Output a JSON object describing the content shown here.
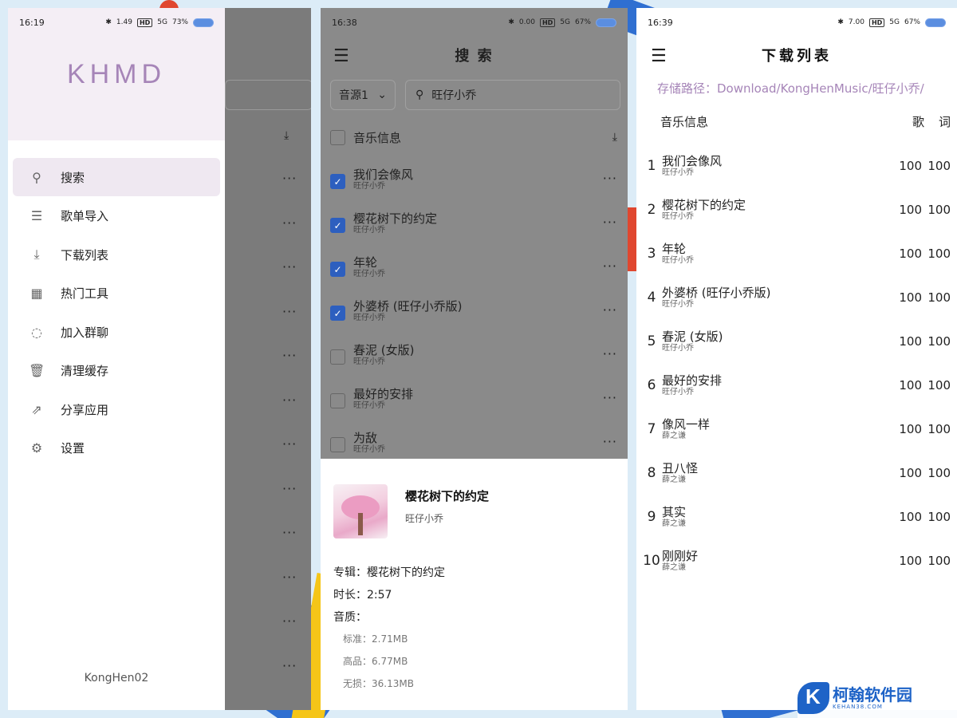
{
  "panel1": {
    "status": {
      "time": "16:19",
      "net": "1.49",
      "signal": "5G",
      "battery": "73%"
    },
    "logo": "KHMD",
    "menu": [
      {
        "label": "搜索",
        "icon": "search-icon",
        "glyph": "⚲"
      },
      {
        "label": "歌单导入",
        "icon": "list-icon",
        "glyph": "☰"
      },
      {
        "label": "下载列表",
        "icon": "download-icon",
        "glyph": "⤓"
      },
      {
        "label": "热门工具",
        "icon": "grid-icon",
        "glyph": "▦"
      },
      {
        "label": "加入群聊",
        "icon": "chat-icon",
        "glyph": "◌"
      },
      {
        "label": "清理缓存",
        "icon": "trash-icon",
        "glyph": "🗑"
      },
      {
        "label": "分享应用",
        "icon": "share-icon",
        "glyph": "⇗"
      },
      {
        "label": "设置",
        "icon": "gear-icon",
        "glyph": "⚙"
      }
    ],
    "footer": "KongHen02"
  },
  "panel2": {
    "status": {
      "time": "16:38",
      "net": "0.00",
      "signal": "5G",
      "battery": "67%"
    },
    "title": "搜 索",
    "source": "音源1",
    "search_value": "旺仔小乔",
    "header_label": "音乐信息",
    "songs": [
      {
        "title": "我们会像风",
        "artist": "旺仔小乔",
        "checked": true
      },
      {
        "title": "樱花树下的约定",
        "artist": "旺仔小乔",
        "checked": true
      },
      {
        "title": "年轮",
        "artist": "旺仔小乔",
        "checked": true
      },
      {
        "title": "外婆桥 (旺仔小乔版)",
        "artist": "旺仔小乔",
        "checked": true
      },
      {
        "title": "春泥 (女版)",
        "artist": "旺仔小乔",
        "checked": false
      },
      {
        "title": "最好的安排",
        "artist": "旺仔小乔",
        "checked": false
      },
      {
        "title": "为敌",
        "artist": "旺仔小乔",
        "checked": false
      }
    ],
    "detail": {
      "title": "樱花树下的约定",
      "artist": "旺仔小乔",
      "album": "专辑：樱花树下的约定",
      "duration": "时长：2:57",
      "quality_label": "音质：",
      "qualities": [
        "标准：2.71MB",
        "高品：6.77MB",
        "无损：36.13MB"
      ]
    }
  },
  "panel3": {
    "status": {
      "time": "16:39",
      "net": "7.00",
      "signal": "5G",
      "battery": "67%"
    },
    "title": "下载列表",
    "path": "存储路径：Download/KongHenMusic/旺仔小乔/",
    "header_label": "音乐信息",
    "col1": "歌",
    "col2": "词",
    "items": [
      {
        "n": "1",
        "title": "我们会像风",
        "artist": "旺仔小乔",
        "v1": "100",
        "v2": "100"
      },
      {
        "n": "2",
        "title": "樱花树下的约定",
        "artist": "旺仔小乔",
        "v1": "100",
        "v2": "100"
      },
      {
        "n": "3",
        "title": "年轮",
        "artist": "旺仔小乔",
        "v1": "100",
        "v2": "100"
      },
      {
        "n": "4",
        "title": "外婆桥 (旺仔小乔版)",
        "artist": "旺仔小乔",
        "v1": "100",
        "v2": "100"
      },
      {
        "n": "5",
        "title": "春泥 (女版)",
        "artist": "旺仔小乔",
        "v1": "100",
        "v2": "100"
      },
      {
        "n": "6",
        "title": "最好的安排",
        "artist": "旺仔小乔",
        "v1": "100",
        "v2": "100"
      },
      {
        "n": "7",
        "title": "像风一样",
        "artist": "薛之谦",
        "v1": "100",
        "v2": "100"
      },
      {
        "n": "8",
        "title": "丑八怪",
        "artist": "薛之谦",
        "v1": "100",
        "v2": "100"
      },
      {
        "n": "9",
        "title": "其实",
        "artist": "薛之谦",
        "v1": "100",
        "v2": "100"
      },
      {
        "n": "10",
        "title": "刚刚好",
        "artist": "薛之谦",
        "v1": "100",
        "v2": "100"
      }
    ]
  },
  "watermark": {
    "name": "柯翰软件园",
    "site": "KEHAN38.COM"
  },
  "colors": {
    "accent": "#a685b8",
    "checkbox": "#2d5fbf",
    "overlay": "#7b7b7b"
  }
}
